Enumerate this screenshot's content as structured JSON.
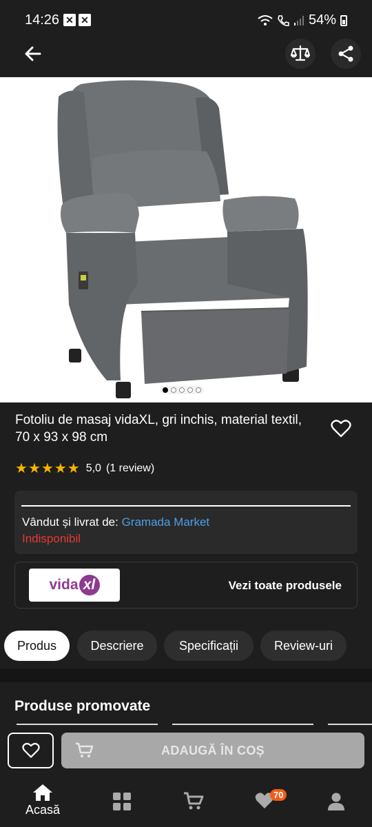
{
  "status_bar": {
    "time": "14:26",
    "battery": "54%"
  },
  "app_bar": {
    "back_icon": "arrow-left-icon",
    "compare_icon": "scale-icon",
    "share_icon": "share-icon"
  },
  "product": {
    "title": "Fotoliu de masaj vidaXL, gri inchis, material textil, 70 x 93 x 98 cm",
    "rating_value": "5,0",
    "rating_count": "(1 review)",
    "stars": 5,
    "image_count": 5,
    "active_image": 1
  },
  "seller": {
    "label": "Vândut și livrat de: ",
    "name": "Gramada Market",
    "availability": "Indisponibil"
  },
  "brand": {
    "logo_text": "vida",
    "logo_suffix": "xl",
    "see_all": "Vezi toate produsele"
  },
  "tabs": [
    {
      "label": "Produs",
      "active": true
    },
    {
      "label": "Descriere",
      "active": false
    },
    {
      "label": "Specificații",
      "active": false
    },
    {
      "label": "Review-uri",
      "active": false
    }
  ],
  "promo": {
    "title": "Produse promovate"
  },
  "cta": {
    "add_to_cart": "ADAUGĂ ÎN COȘ"
  },
  "bottom_nav": {
    "home_label": "Acasă",
    "wishlist_badge": "70"
  },
  "colors": {
    "accent_link": "#4a9fe8",
    "error": "#e53935",
    "star": "#f7b500",
    "badge": "#f25c19"
  }
}
